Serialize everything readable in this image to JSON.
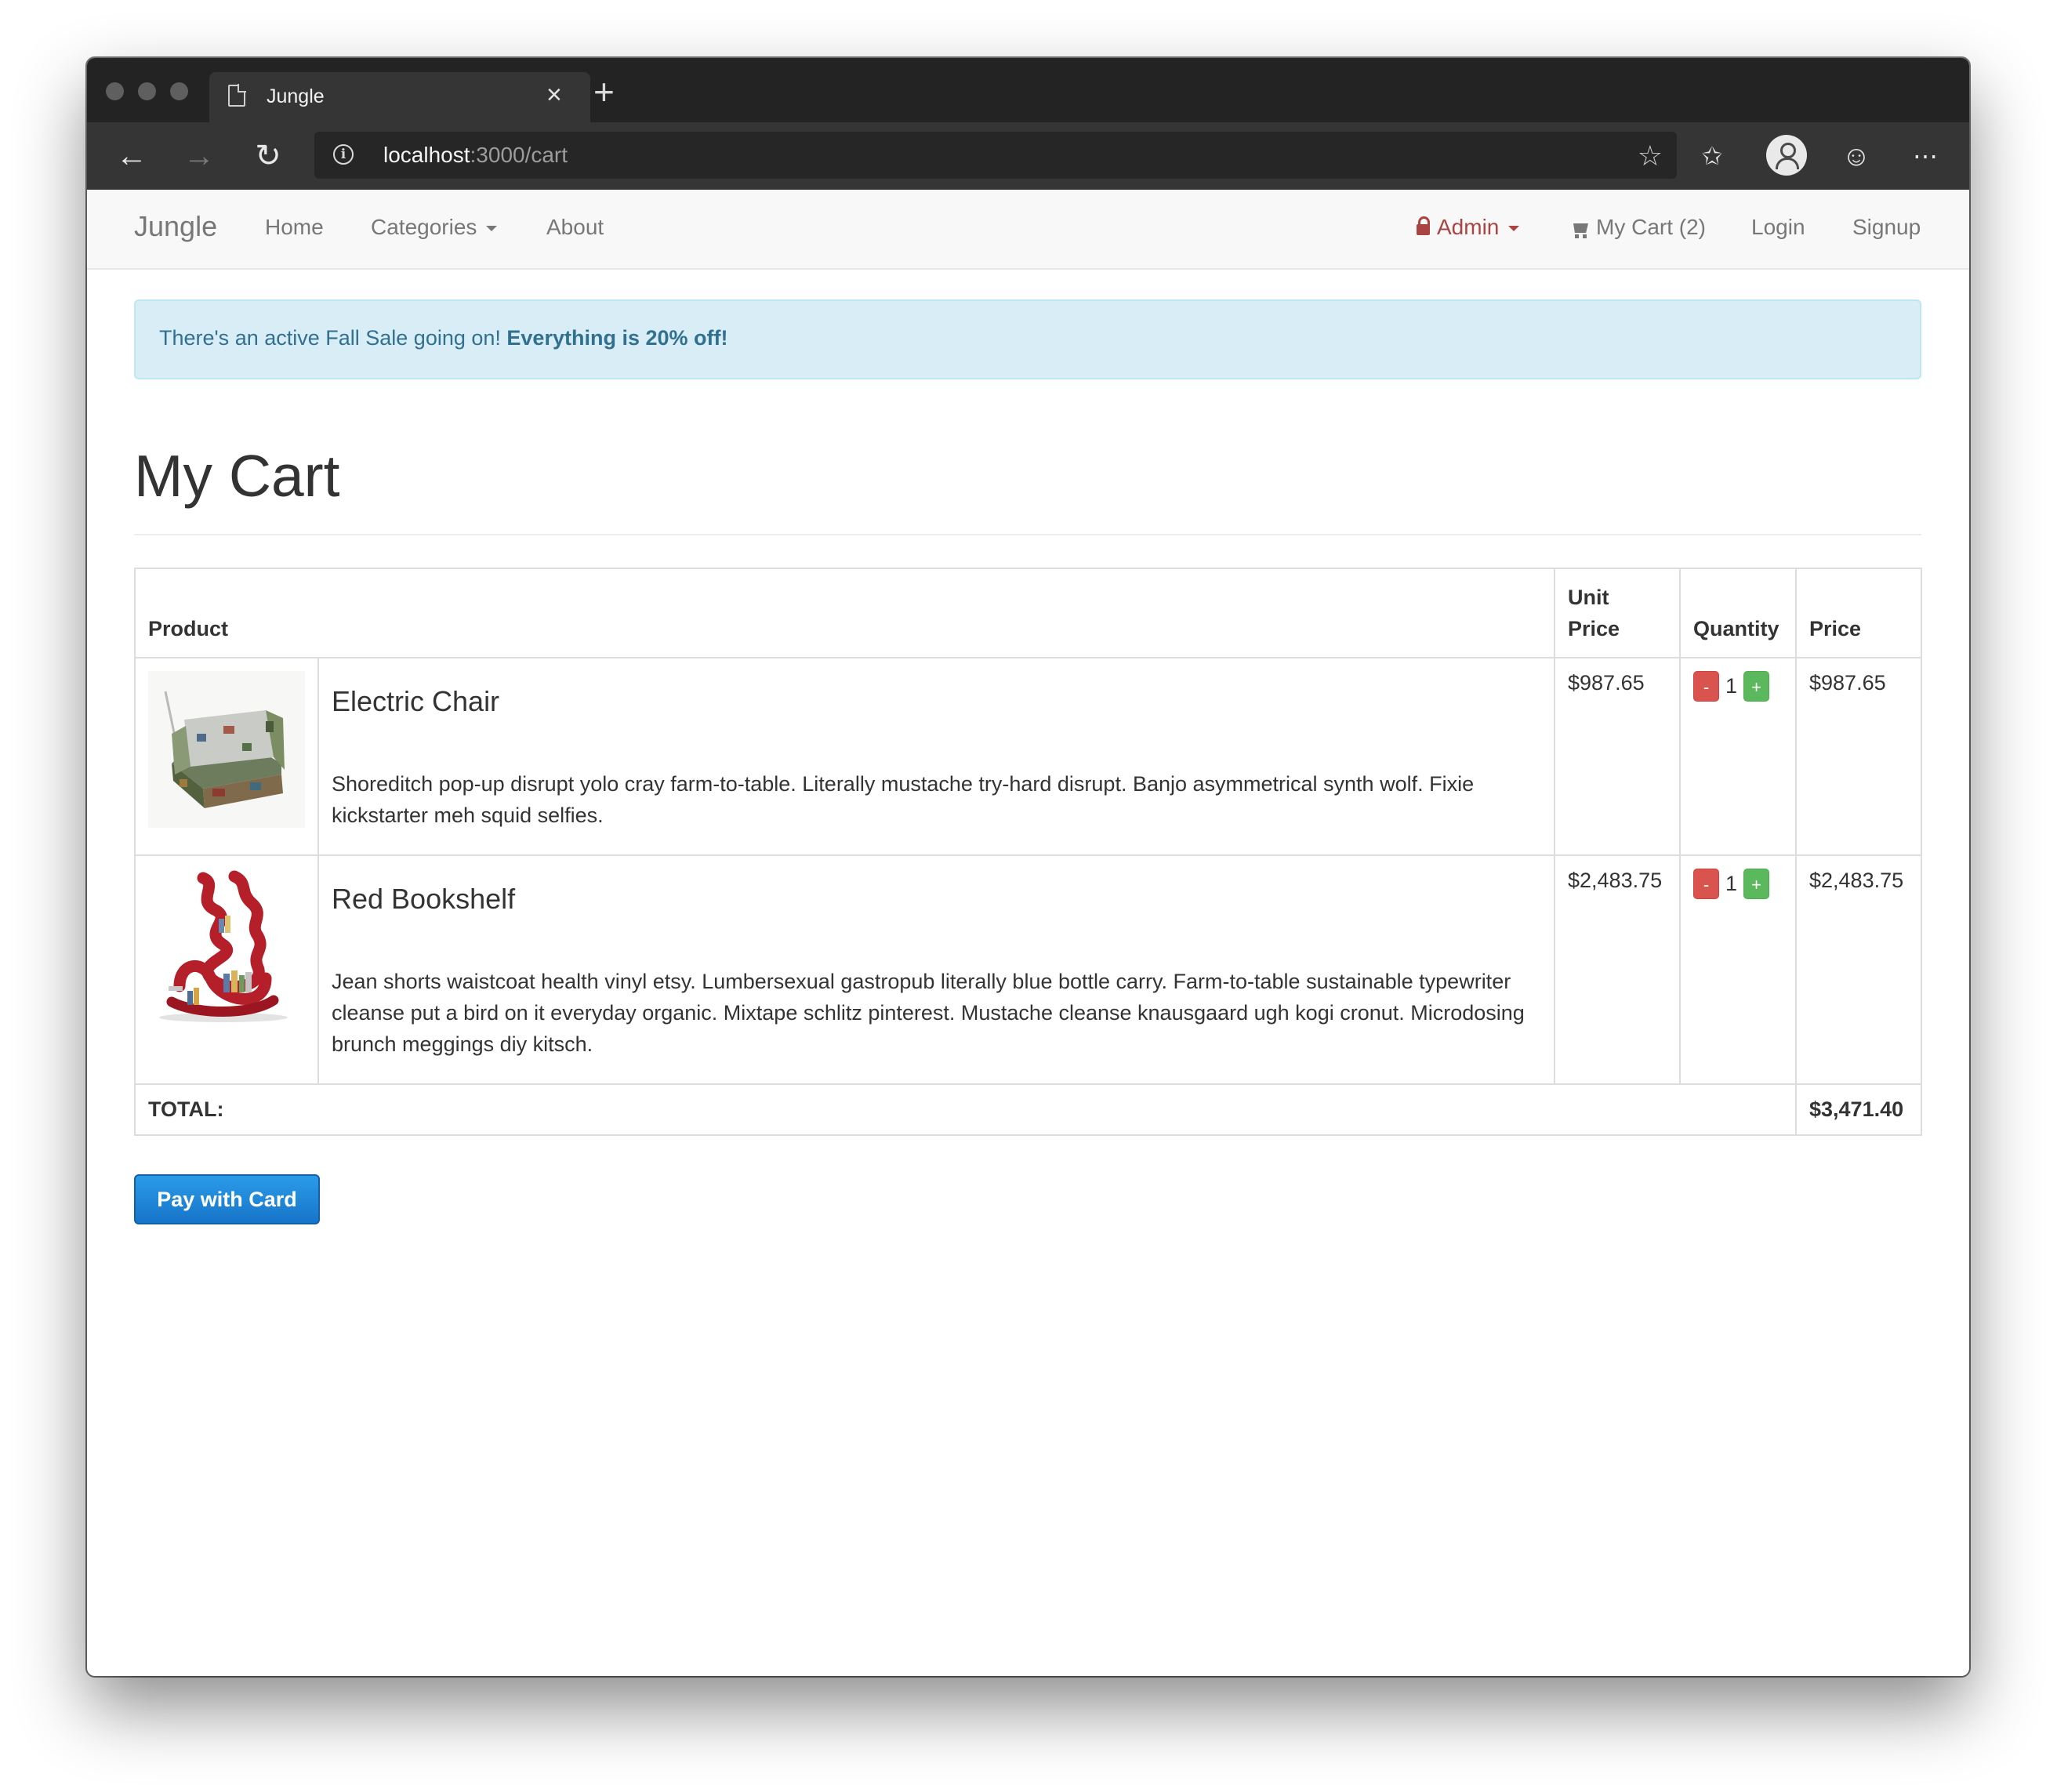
{
  "browser": {
    "tab_title": "Jungle",
    "url_host": "localhost",
    "url_rest": ":3000/cart"
  },
  "navbar": {
    "brand": "Jungle",
    "home": "Home",
    "categories": "Categories",
    "about": "About",
    "admin": "Admin",
    "cart": "My Cart (2)",
    "login": "Login",
    "signup": "Signup"
  },
  "alert": {
    "text": "There's an active Fall Sale going on! ",
    "bold": "Everything is 20% off!"
  },
  "page_title": "My Cart",
  "table": {
    "headers": {
      "product": "Product",
      "unit_price_1": "Unit",
      "unit_price_2": "Price",
      "quantity": "Quantity",
      "price": "Price"
    },
    "items": [
      {
        "name": "Electric Chair",
        "description": "Shoreditch pop-up disrupt yolo cray farm-to-table. Literally mustache try-hard disrupt. Banjo asymmetrical synth wolf. Fixie kickstarter meh squid selfies.",
        "unit_price": "$987.65",
        "quantity": "1",
        "price": "$987.65"
      },
      {
        "name": "Red Bookshelf",
        "description": "Jean shorts waistcoat health vinyl etsy. Lumbersexual gastropub literally blue bottle carry. Farm-to-table sustainable typewriter cleanse put a bird on it everyday organic. Mixtape schlitz pinterest. Mustache cleanse knausgaard ugh kogi cronut. Microdosing brunch meggings diy kitsch.",
        "unit_price": "$2,483.75",
        "quantity": "1",
        "price": "$2,483.75"
      }
    ],
    "minus_label": "-",
    "plus_label": "+",
    "total_label": "TOTAL:",
    "total_value": "$3,471.40"
  },
  "pay_button": "Pay with Card",
  "colors": {
    "alert_bg": "#d9edf7",
    "alert_text": "#31708f",
    "admin": "#a94442",
    "minus_btn": "#d9534f",
    "plus_btn": "#5cb85c",
    "pay_btn": "#1e88d8"
  }
}
